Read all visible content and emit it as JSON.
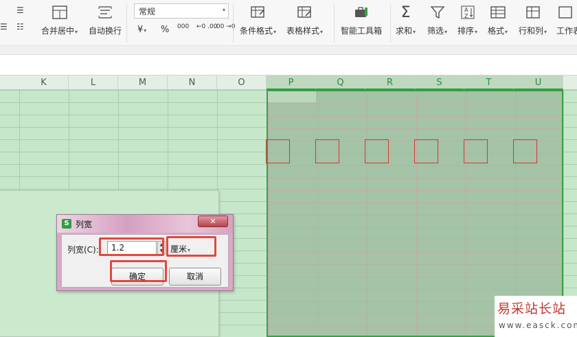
{
  "ribbon": {
    "number_format": "常规",
    "buttons": {
      "merge": "合并居中",
      "wrap": "自动换行",
      "conditional": "条件格式",
      "table_style": "表格样式",
      "smart_tools": "智能工具箱",
      "sum": "求和",
      "filter": "筛选",
      "sort": "排序",
      "format": "格式",
      "row_col": "行和列",
      "worksheet": "工作表"
    },
    "num_icons": {
      "currency": "¥",
      "percent": "%",
      "thousands": "000",
      "inc_decimal": "←0 .00",
      "dec_decimal": ".00 →0"
    }
  },
  "columns": [
    "K",
    "L",
    "M",
    "N",
    "O",
    "P",
    "Q",
    "R",
    "S",
    "T",
    "U"
  ],
  "dialog": {
    "title": "列宽",
    "logo": "S",
    "close": "✕",
    "label": "列宽(C):",
    "value": "1.2",
    "unit": "厘米",
    "ok": "确定",
    "cancel": "取消"
  },
  "watermark": {
    "title": "易采站长站",
    "url": "www.easck.com"
  },
  "colors": {
    "selection_border": "#3aa045",
    "highlight": "#e0483f",
    "grid_bg": "#c6e7c9"
  }
}
